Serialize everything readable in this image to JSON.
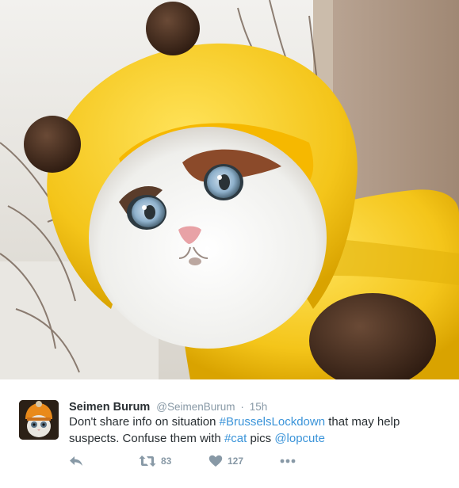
{
  "media": {
    "subject": "cat-in-yellow-hood-photo"
  },
  "tweet": {
    "author_name": "Seimen Burum",
    "author_handle": "@SeimenBurum",
    "separator": "·",
    "timestamp": "15h",
    "text": {
      "part1": "Don't share info on situation ",
      "hashtag1": "#BrusselsLockdown",
      "part2": " that may help suspects. Confuse them with ",
      "hashtag2": "#cat",
      "part3": " pics ",
      "mention": "@lopcute"
    },
    "stats": {
      "retweets": "83",
      "likes": "127"
    }
  },
  "icons": {
    "reply": "reply-icon",
    "retweet": "retweet-icon",
    "like": "heart-icon",
    "more": "more-dots-icon"
  },
  "colors": {
    "link": "#3b94d9",
    "muted": "#8899a6",
    "text": "#292f33"
  }
}
